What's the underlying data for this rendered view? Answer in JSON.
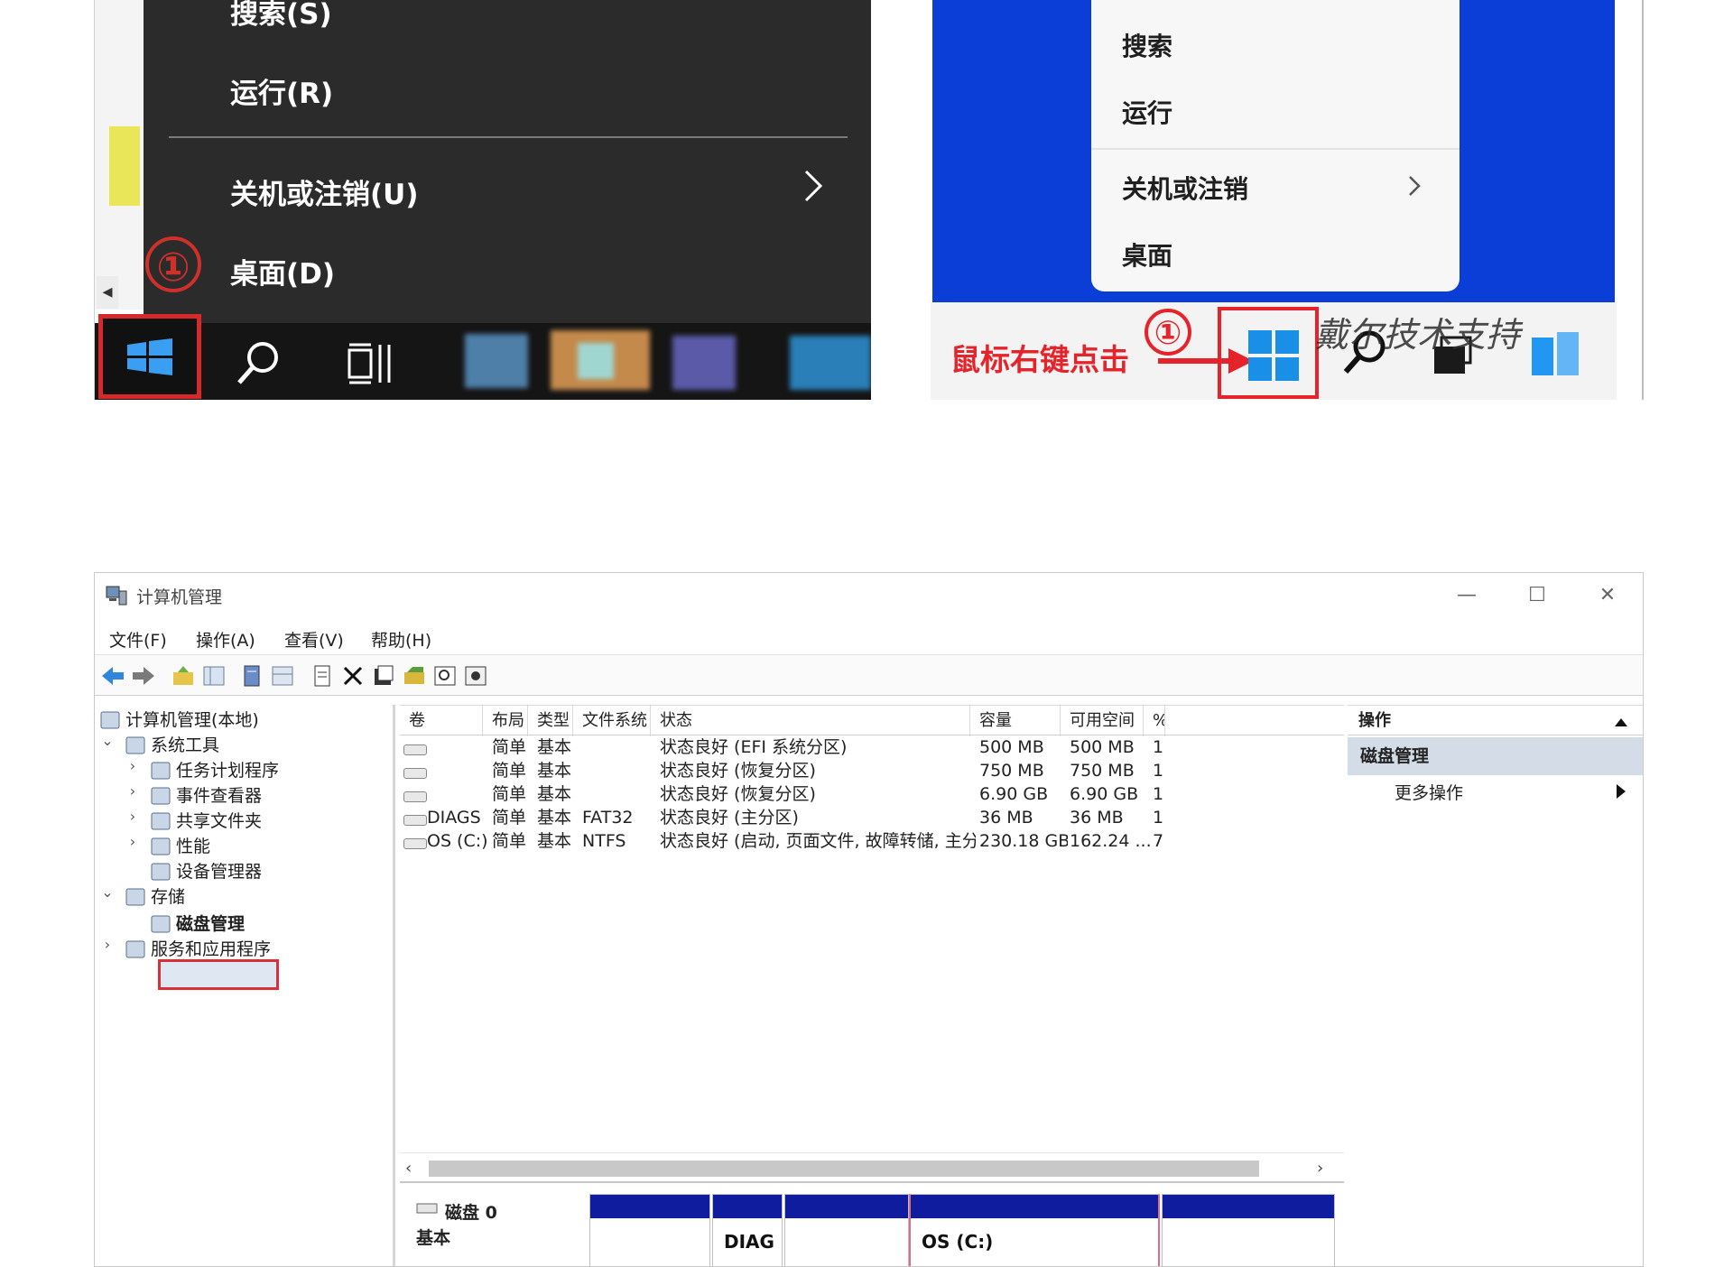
{
  "win10_menu": {
    "items": [
      {
        "label": "搜索(S)"
      },
      {
        "label": "运行(R)"
      },
      {
        "label": "关机或注销(U)"
      },
      {
        "label": "桌面(D)"
      }
    ],
    "step_marker": "①"
  },
  "win11_menu": {
    "items": [
      {
        "label": "搜索"
      },
      {
        "label": "运行"
      },
      {
        "label": "关机或注销"
      },
      {
        "label": "桌面"
      }
    ],
    "step_marker": "①",
    "caption": "鼠标右键点击",
    "watermark": "戴尔技术支持"
  },
  "colors": {
    "highlight_red": "#d62a2a",
    "win11_desktop_blue": "#0a3ed6",
    "partition_bar_blue": "#101c9e"
  },
  "computer_management": {
    "title": "计算机管理",
    "window_buttons": {
      "minimize": "—",
      "maximize": "☐",
      "close": "✕"
    },
    "menus": [
      "文件(F)",
      "操作(A)",
      "查看(V)",
      "帮助(H)"
    ],
    "tree": [
      {
        "label": "计算机管理(本地)",
        "level": 0,
        "caret": "",
        "icon": "computer-management-icon"
      },
      {
        "label": "系统工具",
        "level": 1,
        "caret": "⌄",
        "icon": "system-tools-icon"
      },
      {
        "label": "任务计划程序",
        "level": 2,
        "caret": "›",
        "icon": "task-scheduler-icon"
      },
      {
        "label": "事件查看器",
        "level": 2,
        "caret": "›",
        "icon": "event-viewer-icon"
      },
      {
        "label": "共享文件夹",
        "level": 2,
        "caret": "›",
        "icon": "shared-folders-icon"
      },
      {
        "label": "性能",
        "level": 2,
        "caret": "›",
        "icon": "performance-icon"
      },
      {
        "label": "设备管理器",
        "level": 2,
        "caret": "",
        "icon": "device-manager-icon"
      },
      {
        "label": "存储",
        "level": 1,
        "caret": "⌄",
        "icon": "storage-icon"
      },
      {
        "label": "磁盘管理",
        "level": 2,
        "caret": "",
        "icon": "disk-management-icon"
      },
      {
        "label": "服务和应用程序",
        "level": 1,
        "caret": "›",
        "icon": "services-apps-icon"
      }
    ],
    "volume_columns": [
      "卷",
      "布局",
      "类型",
      "文件系统",
      "状态",
      "容量",
      "可用空间",
      "%"
    ],
    "volumes": [
      {
        "name": "",
        "layout": "简单",
        "type": "基本",
        "fs": "",
        "status": "状态良好 (EFI 系统分区)",
        "capacity": "500 MB",
        "free": "500 MB",
        "pct": "1"
      },
      {
        "name": "",
        "layout": "简单",
        "type": "基本",
        "fs": "",
        "status": "状态良好 (恢复分区)",
        "capacity": "750 MB",
        "free": "750 MB",
        "pct": "1"
      },
      {
        "name": "",
        "layout": "简单",
        "type": "基本",
        "fs": "",
        "status": "状态良好 (恢复分区)",
        "capacity": "6.90 GB",
        "free": "6.90 GB",
        "pct": "1"
      },
      {
        "name": "DIAGS",
        "layout": "简单",
        "type": "基本",
        "fs": "FAT32",
        "status": "状态良好 (主分区)",
        "capacity": "36 MB",
        "free": "36 MB",
        "pct": "1"
      },
      {
        "name": "OS (C:)",
        "layout": "简单",
        "type": "基本",
        "fs": "NTFS",
        "status": "状态良好 (启动, 页面文件, 故障转储, 主分区)",
        "capacity": "230.18 GB",
        "free": "162.24 ...",
        "pct": "7"
      }
    ],
    "disk": {
      "label": "磁盘 0",
      "type": "基本",
      "partitions": [
        "",
        "DIAG",
        "",
        "OS (C:)",
        ""
      ]
    },
    "actions": {
      "header": "操作",
      "section": "磁盘管理",
      "more": "更多操作"
    }
  }
}
